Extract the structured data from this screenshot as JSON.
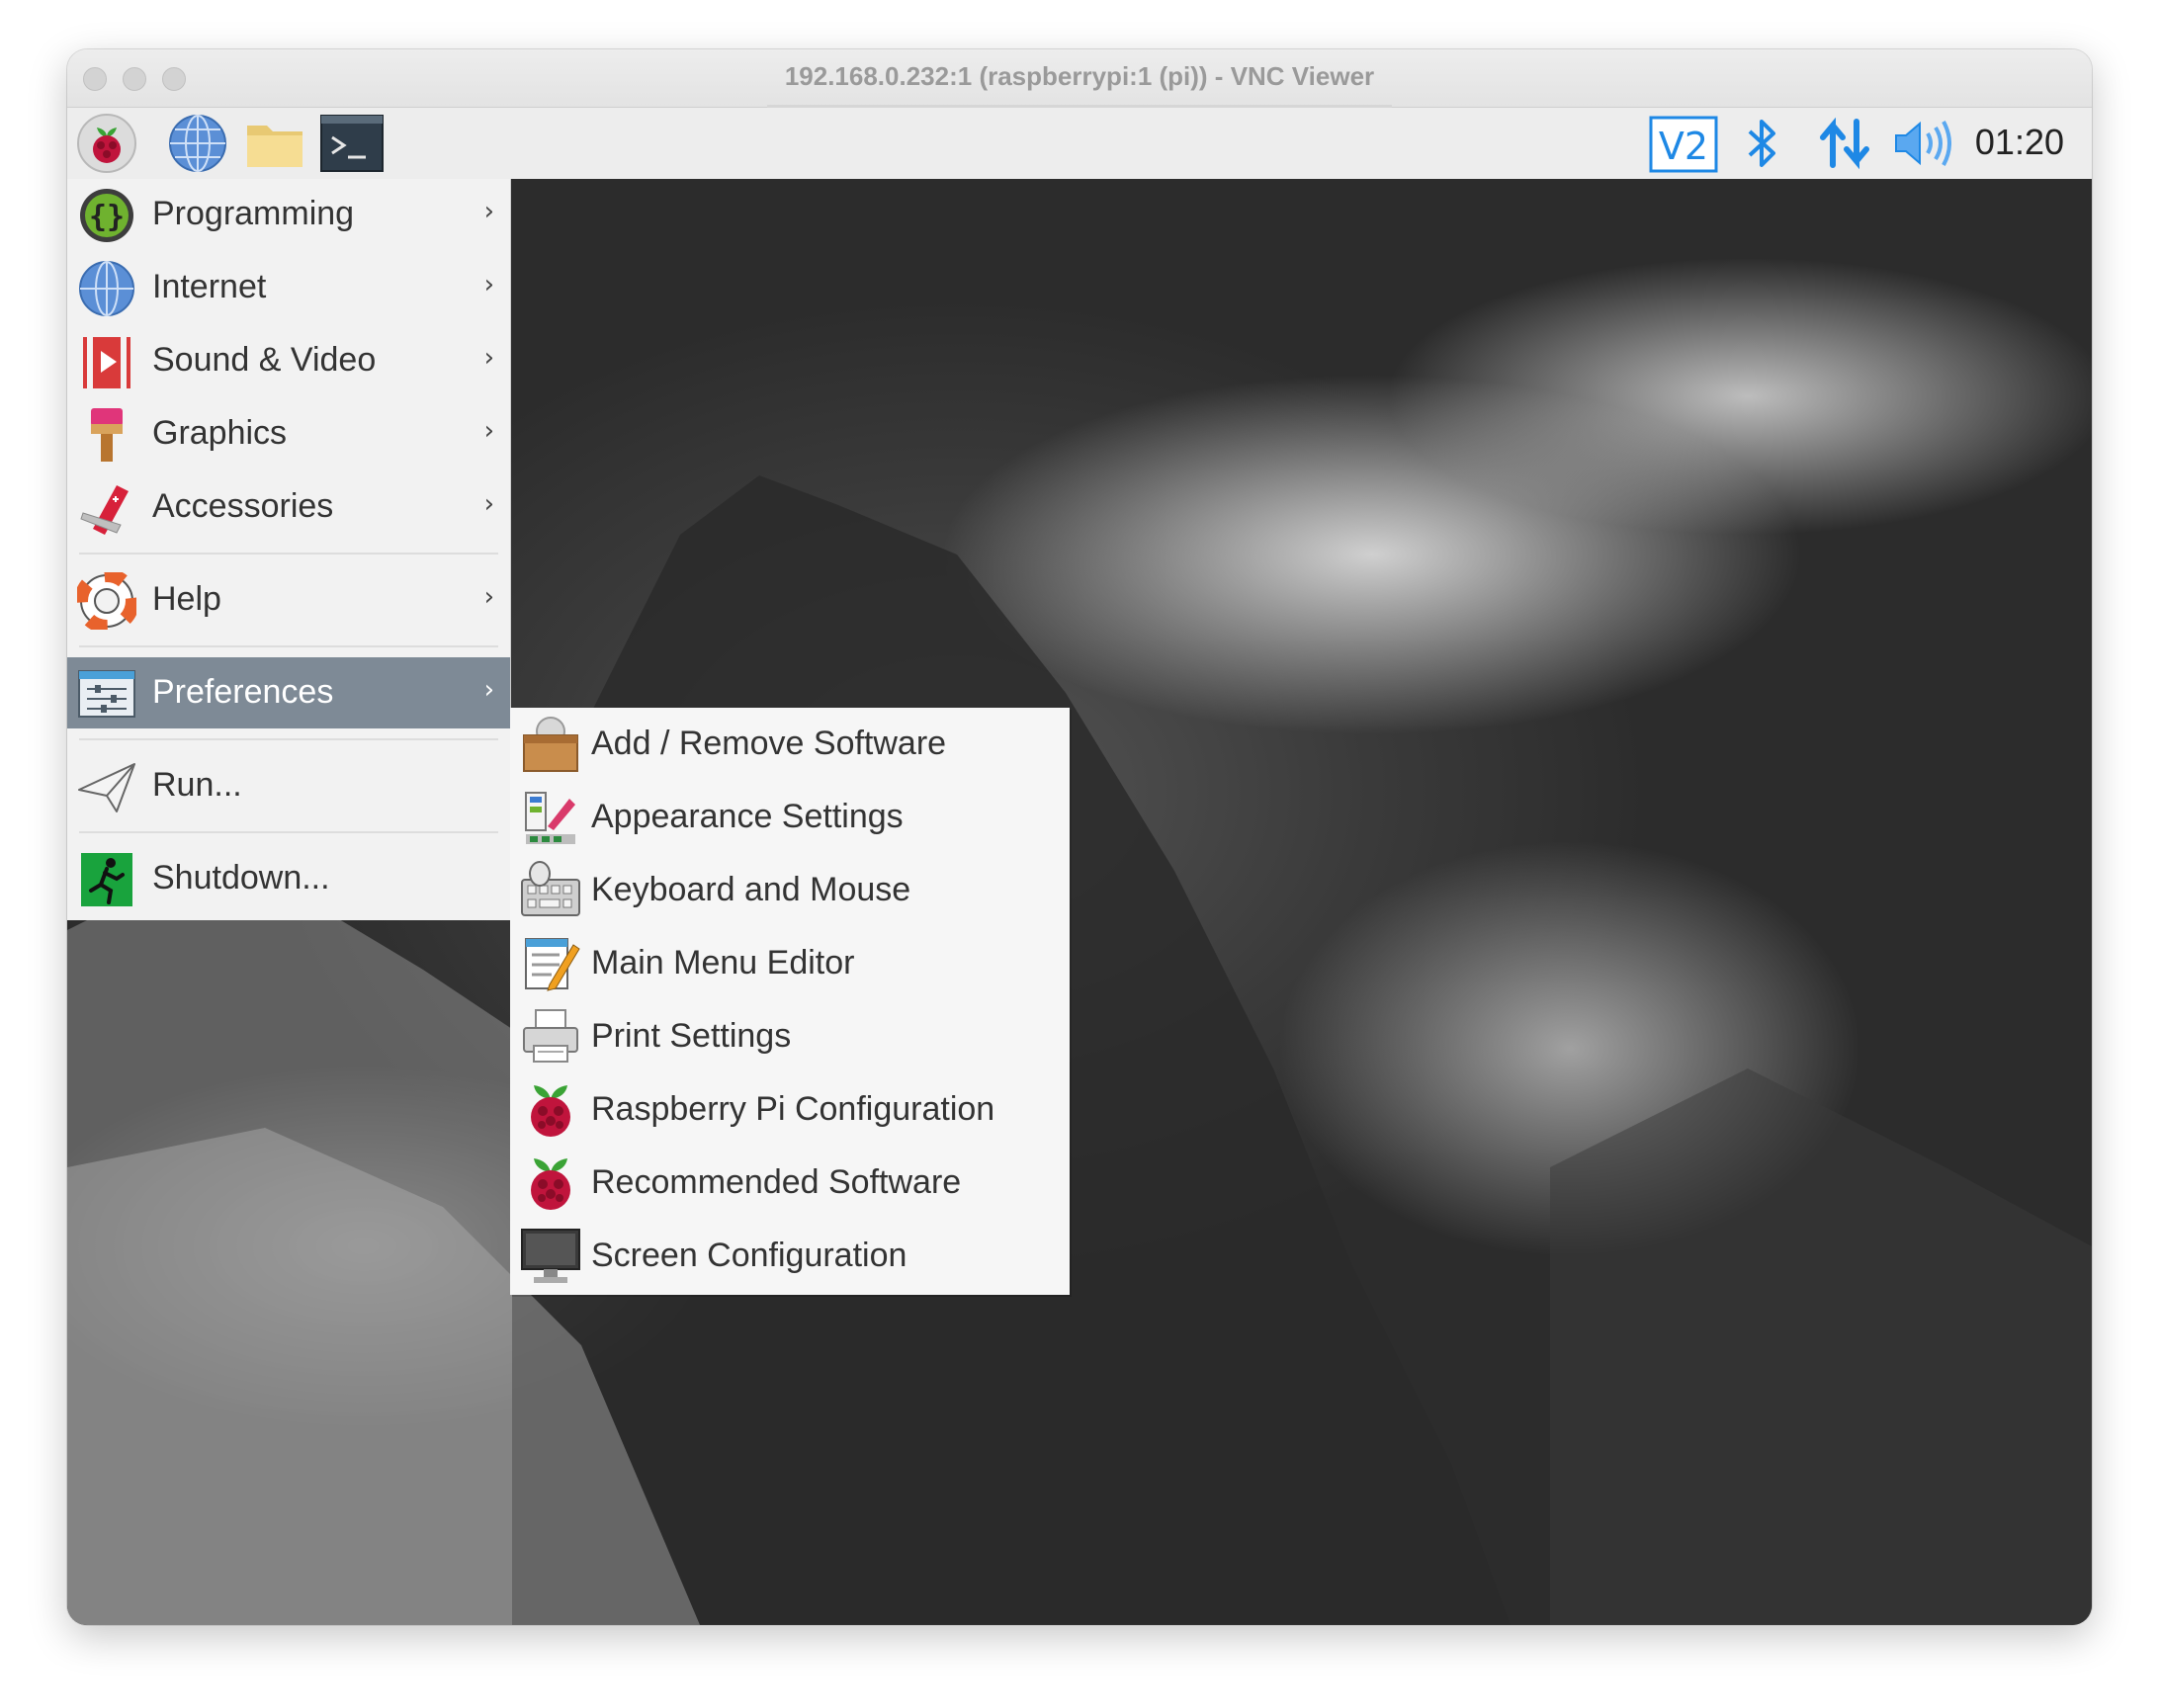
{
  "window": {
    "title": "192.168.0.232:1 (raspberrypi:1 (pi)) - VNC Viewer"
  },
  "taskbar": {
    "launchers": [
      "raspberry-menu-icon",
      "web-browser-icon",
      "file-manager-icon",
      "terminal-icon"
    ],
    "tray": {
      "vnc_label": "V2",
      "clock": "01:20"
    }
  },
  "menu": {
    "items": [
      {
        "label": "Programming",
        "icon": "programming-icon",
        "arrow": "›"
      },
      {
        "label": "Internet",
        "icon": "internet-icon",
        "arrow": "›"
      },
      {
        "label": "Sound & Video",
        "icon": "sound-video-icon",
        "arrow": "›"
      },
      {
        "label": "Graphics",
        "icon": "graphics-icon",
        "arrow": "›"
      },
      {
        "label": "Accessories",
        "icon": "accessories-icon",
        "arrow": "›"
      },
      {
        "label": "Help",
        "icon": "help-icon",
        "arrow": "›"
      },
      {
        "label": "Preferences",
        "icon": "preferences-icon",
        "arrow": "›",
        "active": true
      },
      {
        "label": "Run...",
        "icon": "run-icon"
      },
      {
        "label": "Shutdown...",
        "icon": "shutdown-icon"
      }
    ]
  },
  "submenu": {
    "items": [
      {
        "label": "Add / Remove Software",
        "icon": "package-icon"
      },
      {
        "label": "Appearance Settings",
        "icon": "appearance-icon"
      },
      {
        "label": "Keyboard and Mouse",
        "icon": "keyboard-mouse-icon"
      },
      {
        "label": "Main Menu Editor",
        "icon": "menu-editor-icon"
      },
      {
        "label": "Print Settings",
        "icon": "printer-icon"
      },
      {
        "label": "Raspberry Pi Configuration",
        "icon": "raspberry-icon"
      },
      {
        "label": "Recommended Software",
        "icon": "raspberry-icon"
      },
      {
        "label": "Screen Configuration",
        "icon": "monitor-icon"
      }
    ]
  },
  "colors": {
    "active_item": "#7e8a96",
    "tray_blue": "#1e88e5"
  }
}
